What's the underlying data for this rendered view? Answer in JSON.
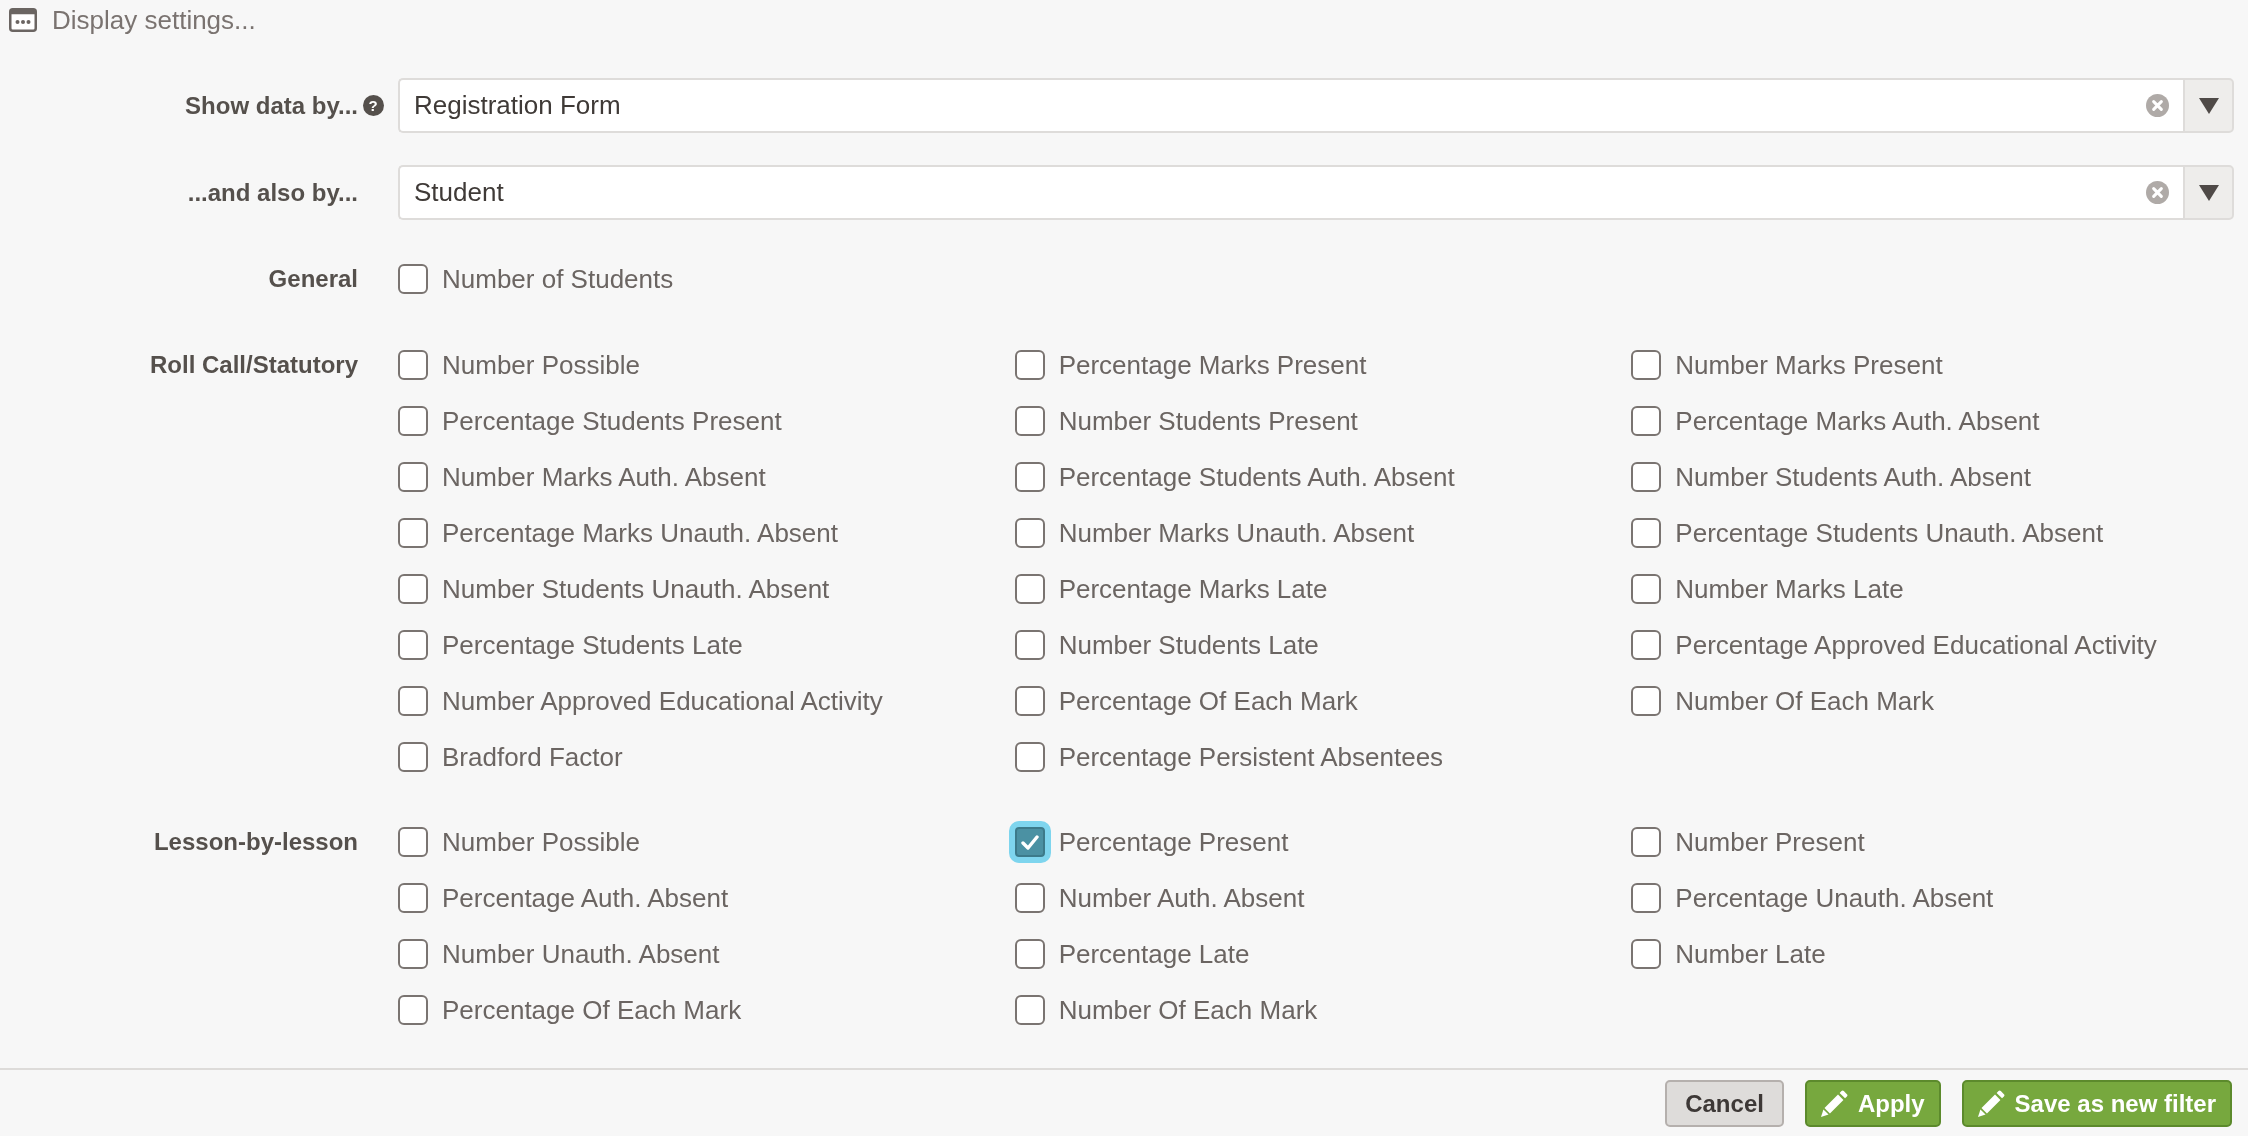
{
  "header": {
    "title": "Display settings..."
  },
  "selects": [
    {
      "label": "Show data by...",
      "help": "?",
      "value": "Registration Form"
    },
    {
      "label": "...and also by...",
      "value": "Student"
    }
  ],
  "sections": [
    {
      "title": "General",
      "options": [
        {
          "label": "Number of Students",
          "checked": false,
          "focused": false
        }
      ]
    },
    {
      "title": "Roll Call/Statutory",
      "options": [
        {
          "label": "Number Possible",
          "checked": false,
          "focused": false
        },
        {
          "label": "Percentage Marks Present",
          "checked": false,
          "focused": false
        },
        {
          "label": "Number Marks Present",
          "checked": false,
          "focused": false
        },
        {
          "label": "Percentage Students Present",
          "checked": false,
          "focused": false
        },
        {
          "label": "Number Students Present",
          "checked": false,
          "focused": false
        },
        {
          "label": "Percentage Marks Auth. Absent",
          "checked": false,
          "focused": false
        },
        {
          "label": "Number Marks Auth. Absent",
          "checked": false,
          "focused": false
        },
        {
          "label": "Percentage Students Auth. Absent",
          "checked": false,
          "focused": false
        },
        {
          "label": "Number Students Auth. Absent",
          "checked": false,
          "focused": false
        },
        {
          "label": "Percentage Marks Unauth. Absent",
          "checked": false,
          "focused": false
        },
        {
          "label": "Number Marks Unauth. Absent",
          "checked": false,
          "focused": false
        },
        {
          "label": "Percentage Students Unauth. Absent",
          "checked": false,
          "focused": false
        },
        {
          "label": "Number Students Unauth. Absent",
          "checked": false,
          "focused": false
        },
        {
          "label": "Percentage Marks Late",
          "checked": false,
          "focused": false
        },
        {
          "label": "Number Marks Late",
          "checked": false,
          "focused": false
        },
        {
          "label": "Percentage Students Late",
          "checked": false,
          "focused": false
        },
        {
          "label": "Number Students Late",
          "checked": false,
          "focused": false
        },
        {
          "label": "Percentage Approved Educational Activity",
          "checked": false,
          "focused": false
        },
        {
          "label": "Number Approved Educational Activity",
          "checked": false,
          "focused": false
        },
        {
          "label": "Percentage Of Each Mark",
          "checked": false,
          "focused": false
        },
        {
          "label": "Number Of Each Mark",
          "checked": false,
          "focused": false
        },
        {
          "label": "Bradford Factor",
          "checked": false,
          "focused": false
        },
        {
          "label": "Percentage Persistent Absentees",
          "checked": false,
          "focused": false
        }
      ]
    },
    {
      "title": "Lesson-by-lesson",
      "options": [
        {
          "label": "Number Possible",
          "checked": false,
          "focused": false
        },
        {
          "label": "Percentage Present",
          "checked": true,
          "focused": true
        },
        {
          "label": "Number Present",
          "checked": false,
          "focused": false
        },
        {
          "label": "Percentage Auth. Absent",
          "checked": false,
          "focused": false
        },
        {
          "label": "Number Auth. Absent",
          "checked": false,
          "focused": false
        },
        {
          "label": "Percentage Unauth. Absent",
          "checked": false,
          "focused": false
        },
        {
          "label": "Number Unauth. Absent",
          "checked": false,
          "focused": false
        },
        {
          "label": "Percentage Late",
          "checked": false,
          "focused": false
        },
        {
          "label": "Number Late",
          "checked": false,
          "focused": false
        },
        {
          "label": "Percentage Of Each Mark",
          "checked": false,
          "focused": false
        },
        {
          "label": "Number Of Each Mark",
          "checked": false,
          "focused": false
        }
      ]
    }
  ],
  "buttons": [
    {
      "label": "Cancel",
      "kind": "secondary"
    },
    {
      "label": "Apply",
      "kind": "primary"
    },
    {
      "label": "Save as new filter",
      "kind": "primary"
    }
  ]
}
